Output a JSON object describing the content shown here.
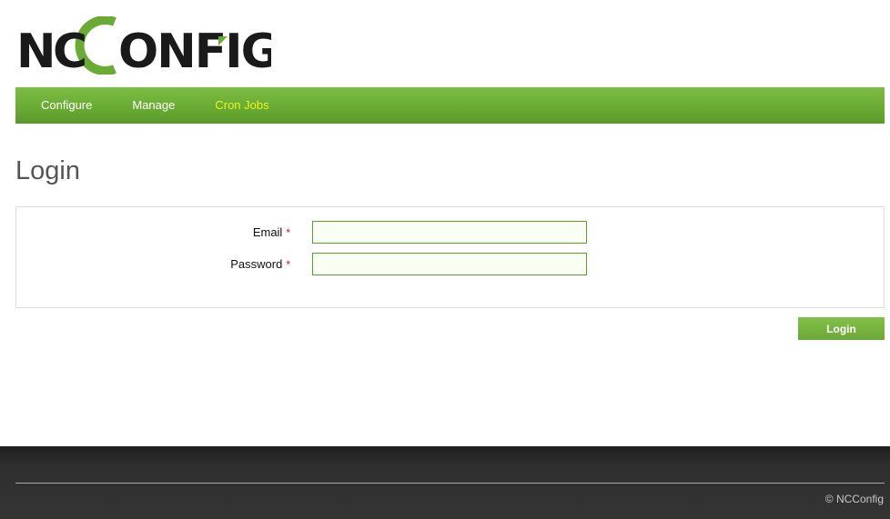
{
  "logo": {
    "text_left": "N",
    "text_c_small": "C",
    "text_right": "ONFIG",
    "brand_green": "#6aab35"
  },
  "nav": {
    "items": [
      {
        "label": "Configure",
        "active": false
      },
      {
        "label": "Manage",
        "active": false
      },
      {
        "label": "Cron Jobs",
        "active": true
      }
    ],
    "active_color": "#eef21a"
  },
  "page": {
    "title": "Login"
  },
  "form": {
    "email_label": "Email",
    "password_label": "Password",
    "required_marker": "*",
    "email_value": "",
    "password_value": ""
  },
  "actions": {
    "login_label": "Login"
  },
  "footer": {
    "copyright": "© NCConfig"
  },
  "colors": {
    "accent": "#6aab35",
    "required": "#cc1111",
    "footer_bg": "#343434"
  }
}
